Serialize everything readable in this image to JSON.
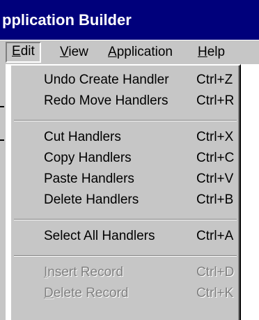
{
  "window": {
    "title": "pplication Builder"
  },
  "menubar": {
    "items": [
      {
        "prefix": "",
        "accel": "E",
        "rest": "dit",
        "open": true
      },
      {
        "prefix": "",
        "accel": "V",
        "rest": "iew",
        "open": false
      },
      {
        "prefix": "",
        "accel": "A",
        "rest": "pplication",
        "open": false
      },
      {
        "prefix": "",
        "accel": "H",
        "rest": "elp",
        "open": false
      }
    ]
  },
  "edit_menu": {
    "items": [
      {
        "label": "Undo Create Handler",
        "shortcut": "Ctrl+Z",
        "enabled": true
      },
      {
        "label": "Redo Move Handlers",
        "shortcut": "Ctrl+R",
        "enabled": true
      },
      {
        "label": "Cut Handlers",
        "shortcut": "Ctrl+X",
        "enabled": true
      },
      {
        "label": "Copy Handlers",
        "shortcut": "Ctrl+C",
        "enabled": true
      },
      {
        "label": "Paste Handlers",
        "shortcut": "Ctrl+V",
        "enabled": true
      },
      {
        "label": "Delete Handlers",
        "shortcut": "Ctrl+B",
        "enabled": true
      },
      {
        "label": "Select All Handlers",
        "shortcut": "Ctrl+A",
        "enabled": true
      },
      {
        "accel": "I",
        "rest": "nsert Record",
        "shortcut": "Ctrl+D",
        "enabled": false
      },
      {
        "accel": "D",
        "rest": "elete Record",
        "shortcut": "Ctrl+K",
        "enabled": false
      }
    ]
  },
  "colors": {
    "titlebar": "#00007b",
    "menu_face": "#c6c6c6",
    "disabled_text": "#808080"
  }
}
